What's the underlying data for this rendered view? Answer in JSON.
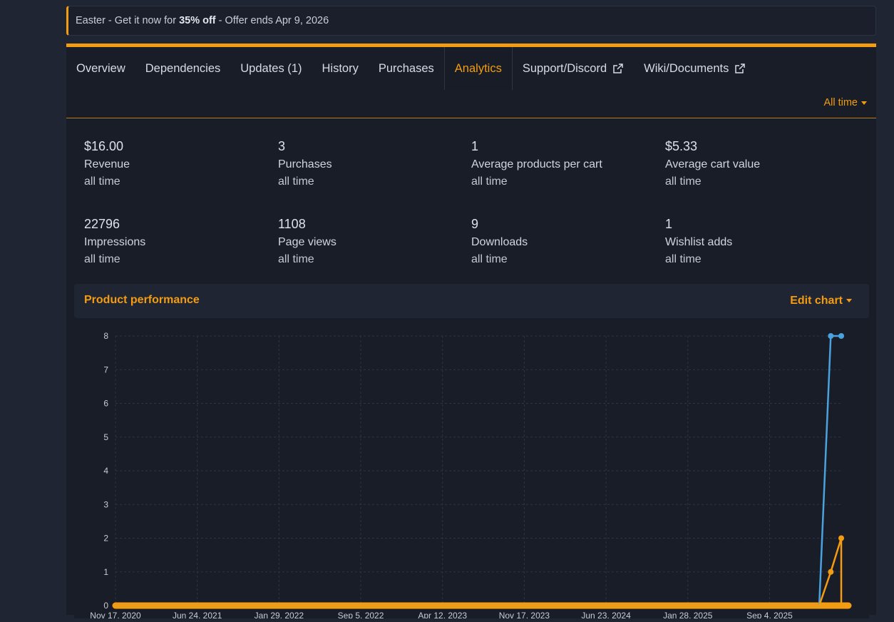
{
  "banner": {
    "prefix": "Easter - Get it now for ",
    "bold": "35% off",
    "suffix": " - Offer ends Apr 9, 2026"
  },
  "tabs": [
    {
      "label": "Overview"
    },
    {
      "label": "Dependencies"
    },
    {
      "label": "Updates (1)"
    },
    {
      "label": "History"
    },
    {
      "label": "Purchases"
    },
    {
      "label": "Analytics",
      "active": true
    },
    {
      "label": "Support/Discord",
      "icon": "external-link-icon"
    },
    {
      "label": "Wiki/Documents",
      "icon": "external-link-icon"
    }
  ],
  "period_selector": "All time",
  "stats": [
    {
      "value": "$16.00",
      "label": "Revenue",
      "sub": "all time"
    },
    {
      "value": "3",
      "label": "Purchases",
      "sub": "all time"
    },
    {
      "value": "1",
      "label": "Average products per cart",
      "sub": "all time"
    },
    {
      "value": "$5.33",
      "label": "Average cart value",
      "sub": "all time"
    },
    {
      "value": "22796",
      "label": "Impressions",
      "sub": "all time"
    },
    {
      "value": "1108",
      "label": "Page views",
      "sub": "all time"
    },
    {
      "value": "9",
      "label": "Downloads",
      "sub": "all time"
    },
    {
      "value": "1",
      "label": "Wishlist adds",
      "sub": "all time"
    }
  ],
  "performance": {
    "title": "Product performance",
    "edit_label": "Edit chart"
  },
  "colors": {
    "accent": "#f39c12",
    "series_blue": "#4aa3df",
    "series_orange": "#f39c12"
  },
  "chart_data": {
    "type": "line",
    "ylim": [
      0,
      8
    ],
    "yticks": [
      0,
      1,
      2,
      3,
      4,
      5,
      6,
      7,
      8
    ],
    "xtick_labels": [
      "Nov 17, 2020",
      "Jun 24, 2021",
      "Jan 29, 2022",
      "Sep 5, 2022",
      "Apr 12, 2023",
      "Nov 17, 2023",
      "Jun 23, 2024",
      "Jan 28, 2025",
      "Sep 4, 2025"
    ],
    "xlim": [
      "Nov 17, 2020",
      "Mar 2026"
    ],
    "grid": true,
    "series": [
      {
        "color": "#4aa3df",
        "points": [
          {
            "x": "Nov 17, 2020",
            "y": 0
          },
          {
            "x": "Jan 2026",
            "y": 0
          },
          {
            "x": "Feb 2026",
            "y": 8
          },
          {
            "x": "Mar 2026",
            "y": 8
          }
        ]
      },
      {
        "color": "#f39c12",
        "points": [
          {
            "x": "Nov 17, 2020",
            "y": 0
          },
          {
            "x": "Jan 2026",
            "y": 0
          },
          {
            "x": "Feb 2026",
            "y": 1
          },
          {
            "x": "Mar 2026",
            "y": 2
          },
          {
            "x": "Mar 2026",
            "y": 0
          }
        ]
      }
    ]
  }
}
